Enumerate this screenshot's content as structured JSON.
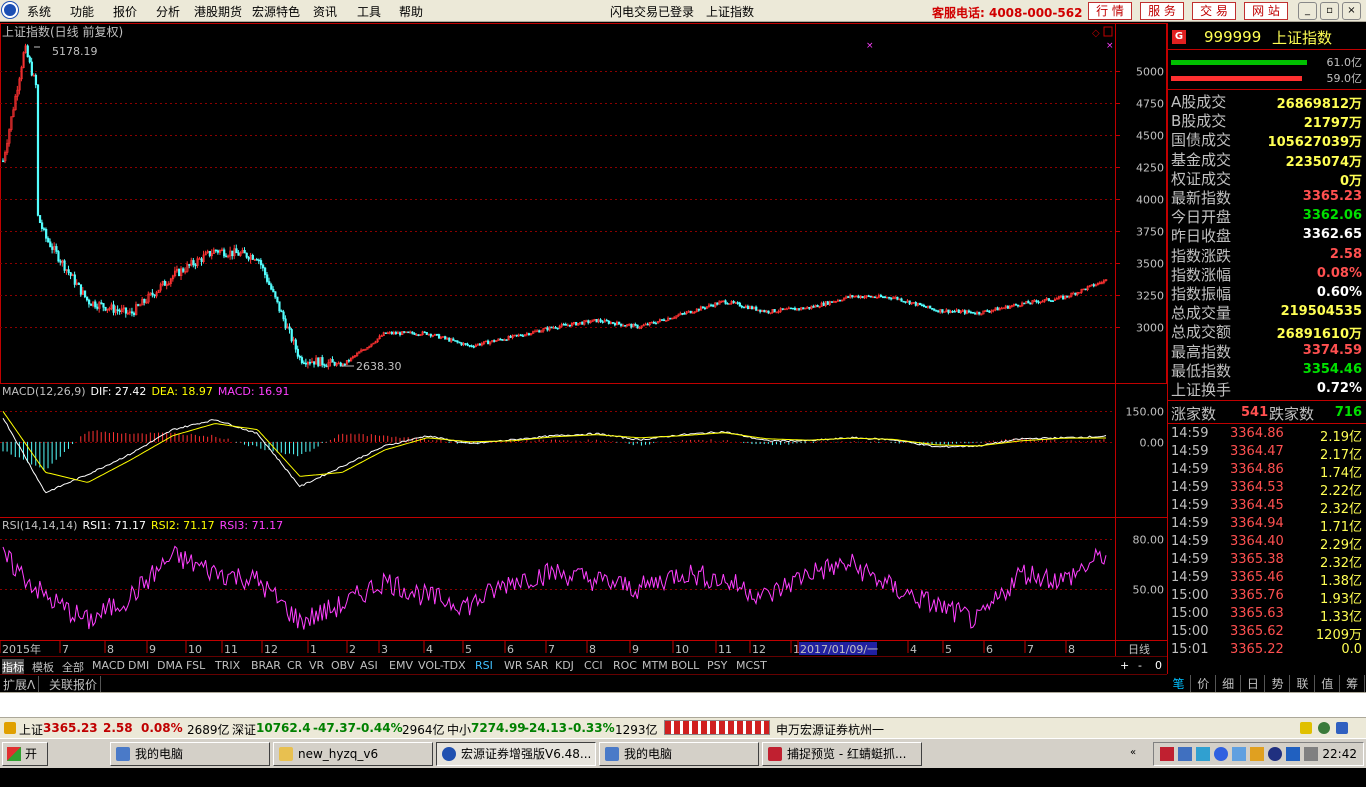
{
  "menu": {
    "items": [
      "系统",
      "功能",
      "报价",
      "分析",
      "港股期货",
      "宏源特色",
      "资讯",
      "工具",
      "帮助"
    ],
    "center_status": "闪电交易已登录",
    "center_title": "上证指数",
    "service_phone": "客服电话: 4008-000-562",
    "top_buttons": [
      "行 情",
      "服 务",
      "交 易",
      "网 站"
    ]
  },
  "chart": {
    "title": "上证指数(日线 前复权)",
    "high_label": "5178.19",
    "low_label": "2638.30",
    "price_axis": [
      "5000",
      "4750",
      "4500",
      "4250",
      "4000",
      "3750",
      "3500",
      "3250",
      "3000"
    ],
    "macd_header": {
      "name": "MACD(12,26,9)",
      "dif": "DIF: 27.42",
      "dea": "DEA: 18.97",
      "macd": "MACD: 16.91"
    },
    "macd_axis": [
      "150.00",
      "0.00"
    ],
    "rsi_header": {
      "name": "RSI(14,14,14)",
      "rsi1": "RSI1: 71.17",
      "rsi2": "RSI2: 71.17",
      "rsi3": "RSI3: 71.17"
    },
    "rsi_axis": [
      "80.00",
      "50.00"
    ],
    "date_axis": [
      "2015年",
      "7",
      "8",
      "9",
      "10",
      "11",
      "12",
      "1",
      "2",
      "3",
      "4",
      "5",
      "6",
      "7",
      "8",
      "9",
      "10",
      "11",
      "12",
      "1",
      "2017/01/09/一",
      "4",
      "5",
      "6",
      "7",
      "8"
    ],
    "axis_corner": "日线",
    "colors": {
      "up": "#ff3232",
      "down": "#54ffff",
      "grid": "#8b0000",
      "axis": "#c00000",
      "dif": "#ffffff",
      "dea": "#ffff00",
      "rsi": "#ff40ff"
    }
  },
  "chart_data": [
    {
      "type": "line",
      "title": "上证指数(日线 前复权)",
      "ylim": [
        2600,
        5300
      ],
      "annotations": [
        {
          "label": "5178.19",
          "kind": "high"
        },
        {
          "label": "2638.30",
          "kind": "low"
        }
      ],
      "series": [
        {
          "name": "",
          "x": [
            "2015-06",
            "2015-07",
            "2015-08",
            "2015-09",
            "2015-10",
            "2015-11",
            "2015-12",
            "2016-01",
            "2016-02",
            "2016-03",
            "2016-04",
            "2016-05",
            "2016-06",
            "2016-07",
            "2016-08",
            "2016-09",
            "2016-10",
            "2016-11",
            "2016-12",
            "2017-01",
            "2017-02",
            "2017-03",
            "2017-04",
            "2017-05",
            "2017-06",
            "2017-07",
            "2017-08"
          ],
          "values": [
            4600,
            3700,
            3200,
            3100,
            3400,
            3600,
            3550,
            2750,
            2700,
            2950,
            2950,
            2850,
            2920,
            3000,
            3050,
            3000,
            3100,
            3200,
            3120,
            3150,
            3240,
            3230,
            3130,
            3110,
            3180,
            3230,
            3365
          ]
        }
      ]
    },
    {
      "type": "line",
      "title": "MACD(12,26,9)",
      "ylim": [
        -350,
        250
      ],
      "series": [
        {
          "name": "DIF",
          "values": [
            120,
            -250,
            -160,
            -60,
            60,
            110,
            40,
            -220,
            -120,
            -20,
            30,
            -10,
            10,
            30,
            40,
            10,
            35,
            50,
            5,
            5,
            20,
            10,
            -25,
            -20,
            15,
            20,
            27.42
          ]
        },
        {
          "name": "DEA",
          "values": [
            150,
            -150,
            -200,
            -90,
            30,
            90,
            60,
            -170,
            -150,
            -40,
            20,
            0,
            5,
            25,
            35,
            20,
            30,
            45,
            15,
            8,
            18,
            12,
            -15,
            -20,
            5,
            18,
            18.97
          ]
        }
      ]
    },
    {
      "type": "line",
      "title": "RSI(14,14,14)",
      "ylim": [
        20,
        90
      ],
      "series": [
        {
          "name": "RSI1",
          "values": [
            70,
            45,
            30,
            45,
            70,
            60,
            55,
            30,
            40,
            55,
            45,
            40,
            55,
            60,
            55,
            50,
            60,
            55,
            45,
            60,
            65,
            50,
            40,
            30,
            60,
            55,
            71.17
          ]
        }
      ]
    }
  ],
  "quote": {
    "code": "999999",
    "name": "上证指数",
    "bars": [
      {
        "label": "61.0亿",
        "color": "#00c000",
        "fill": 0.85
      },
      {
        "label": "59.0亿",
        "color": "#ff3030",
        "fill": 0.82
      }
    ],
    "stats": [
      {
        "label": "A股成交",
        "value": "26869812万",
        "color": "#ffff54"
      },
      {
        "label": "B股成交",
        "value": "21797万",
        "color": "#ffff54"
      },
      {
        "label": "国债成交",
        "value": "105627039万",
        "color": "#ffff54"
      },
      {
        "label": "基金成交",
        "value": "2235074万",
        "color": "#ffff54"
      },
      {
        "label": "权证成交",
        "value": "0万",
        "color": "#ffff54"
      },
      {
        "label": "最新指数",
        "value": "3365.23",
        "color": "#ff5050"
      },
      {
        "label": "今日开盘",
        "value": "3362.06",
        "color": "#00e000"
      },
      {
        "label": "昨日收盘",
        "value": "3362.65",
        "color": "#ffffff"
      },
      {
        "label": "指数涨跌",
        "value": "2.58",
        "color": "#ff5050"
      },
      {
        "label": "指数涨幅",
        "value": "0.08%",
        "color": "#ff5050"
      },
      {
        "label": "指数振幅",
        "value": "0.60%",
        "color": "#ffffff"
      },
      {
        "label": "总成交量",
        "value": "219504535",
        "color": "#ffff54"
      },
      {
        "label": "总成交额",
        "value": "26891610万",
        "color": "#ffff54"
      },
      {
        "label": "最高指数",
        "value": "3374.59",
        "color": "#ff5050"
      },
      {
        "label": "最低指数",
        "value": "3354.46",
        "color": "#00e000"
      },
      {
        "label": "上证换手",
        "value": "0.72%",
        "color": "#ffffff"
      }
    ],
    "breadth": {
      "up_label": "涨家数",
      "up_value": "541",
      "down_label": "跌家数",
      "down_value": "716"
    },
    "ticks": [
      {
        "time": "14:59",
        "price": "3364.86",
        "vol": "2.19亿"
      },
      {
        "time": "14:59",
        "price": "3364.47",
        "vol": "2.17亿"
      },
      {
        "time": "14:59",
        "price": "3364.86",
        "vol": "1.74亿"
      },
      {
        "time": "14:59",
        "price": "3364.53",
        "vol": "2.22亿"
      },
      {
        "time": "14:59",
        "price": "3364.45",
        "vol": "2.32亿"
      },
      {
        "time": "14:59",
        "price": "3364.94",
        "vol": "1.71亿"
      },
      {
        "time": "14:59",
        "price": "3364.40",
        "vol": "2.29亿"
      },
      {
        "time": "14:59",
        "price": "3365.38",
        "vol": "2.32亿"
      },
      {
        "time": "14:59",
        "price": "3365.46",
        "vol": "1.38亿"
      },
      {
        "time": "15:00",
        "price": "3365.76",
        "vol": "1.93亿"
      },
      {
        "time": "15:00",
        "price": "3365.63",
        "vol": "1.33亿"
      },
      {
        "time": "15:00",
        "price": "3365.62",
        "vol": "1209万"
      },
      {
        "time": "15:01",
        "price": "3365.22",
        "vol": "0.0"
      }
    ],
    "tabs": [
      "笔",
      "价",
      "细",
      "日",
      "势",
      "联",
      "值",
      "筹"
    ]
  },
  "indicators": [
    "指标",
    "模板",
    "全部",
    "MACD",
    "DMI",
    "DMA",
    "FSL",
    "TRIX",
    "BRAR",
    "CR",
    "VR",
    "OBV",
    "ASI",
    "EMV",
    "VOL-TDX",
    "RSI",
    "WR",
    "SAR",
    "KDJ",
    "CCI",
    "ROC",
    "MTM",
    "BOLL",
    "PSY",
    "MCST"
  ],
  "indicator_controls": [
    "+",
    "-",
    "0"
  ],
  "ext_tabs": [
    "扩展Λ",
    "关联报价"
  ],
  "status": {
    "sh_label": "上证",
    "sh_price": "3365.23",
    "sh_chg": "2.58",
    "sh_pct": "0.08%",
    "sh_amt": "2689亿",
    "sz_label": "深证",
    "sz_price": "10762.4",
    "sz_chg": "-47.37",
    "sz_pct": "-0.44%",
    "sz_amt": "2964亿",
    "zx_label": "中小",
    "zx_price": "7274.99",
    "zx_chg": "-24.13",
    "zx_pct": "-0.33%",
    "zx_amt": "1293亿",
    "broker": "申万宏源证券杭州一"
  },
  "taskbar": {
    "start": "开始",
    "tasks": [
      "我的电脑",
      "new_hyzq_v6",
      "宏源证券增强版V6.48...",
      "我的电脑",
      "捕捉预览 - 红蜻蜓抓..."
    ],
    "clock": "22:42"
  }
}
